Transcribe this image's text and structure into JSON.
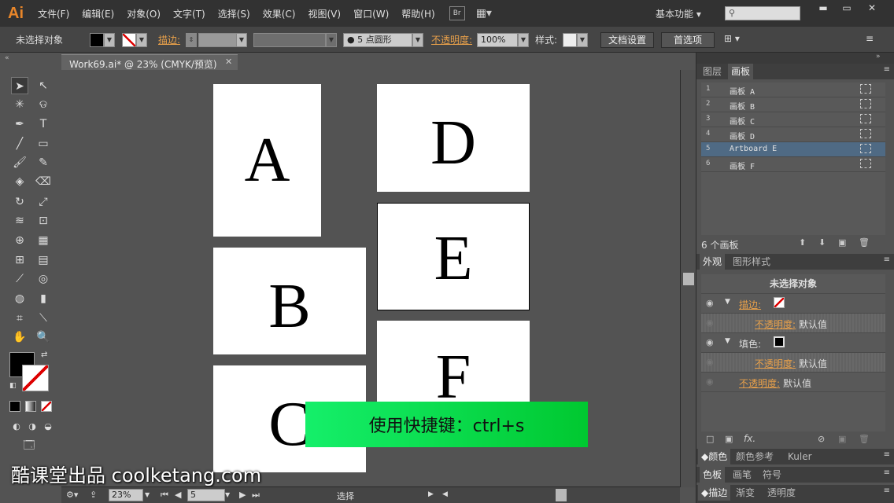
{
  "menubar": {
    "logo": "Ai",
    "items": [
      "文件(F)",
      "编辑(E)",
      "对象(O)",
      "文字(T)",
      "选择(S)",
      "效果(C)",
      "视图(V)",
      "窗口(W)",
      "帮助(H)"
    ],
    "bridge": "Br",
    "workspace": "基本功能",
    "search_placeholder": ""
  },
  "controlbar": {
    "selection": "未选择对象",
    "stroke_label": "描边:",
    "brush": "5 点圆形",
    "opacity_label": "不透明度:",
    "opacity_value": "100%",
    "style_label": "样式:",
    "doc_setup": "文档设置",
    "preferences": "首选项"
  },
  "document": {
    "tab_title": "Work69.ai* @ 23% (CMYK/预览)"
  },
  "artboards": [
    {
      "letter": "A"
    },
    {
      "letter": "B"
    },
    {
      "letter": "C"
    },
    {
      "letter": "D"
    },
    {
      "letter": "E"
    },
    {
      "letter": "F"
    }
  ],
  "overlay": {
    "subtitle": "使用快捷键：ctrl+s",
    "watermark": "酷课堂出品 coolketang.com"
  },
  "statusbar": {
    "zoom": "23%",
    "artboard_num": "5",
    "tool": "选择"
  },
  "panels": {
    "tabs_top": [
      "图层",
      "画板"
    ],
    "artboard_list": [
      {
        "num": "1",
        "name": "画板 A"
      },
      {
        "num": "2",
        "name": "画板 B"
      },
      {
        "num": "3",
        "name": "画板 C"
      },
      {
        "num": "4",
        "name": "画板 D"
      },
      {
        "num": "5",
        "name": "Artboard E"
      },
      {
        "num": "6",
        "name": "画板 F"
      }
    ],
    "selected_index": 4,
    "artboard_count": "6 个画板",
    "tabs_appearance": [
      "外观",
      "图形样式"
    ],
    "appearance": {
      "title": "未选择对象",
      "stroke_label": "描边:",
      "opacity_label": "不透明度:",
      "default_value": "默认值",
      "fill_label": "填色:"
    },
    "tabs_color": [
      "颜色",
      "颜色参考",
      "Kuler"
    ],
    "tabs_swatches": [
      "色板",
      "画笔",
      "符号"
    ],
    "tabs_stroke": [
      "描边",
      "渐变",
      "透明度"
    ]
  },
  "colors": {
    "accent_orange": "#e8a04a",
    "selected_row": "#4f6a84",
    "subtitle_green": "#15ef6a"
  }
}
